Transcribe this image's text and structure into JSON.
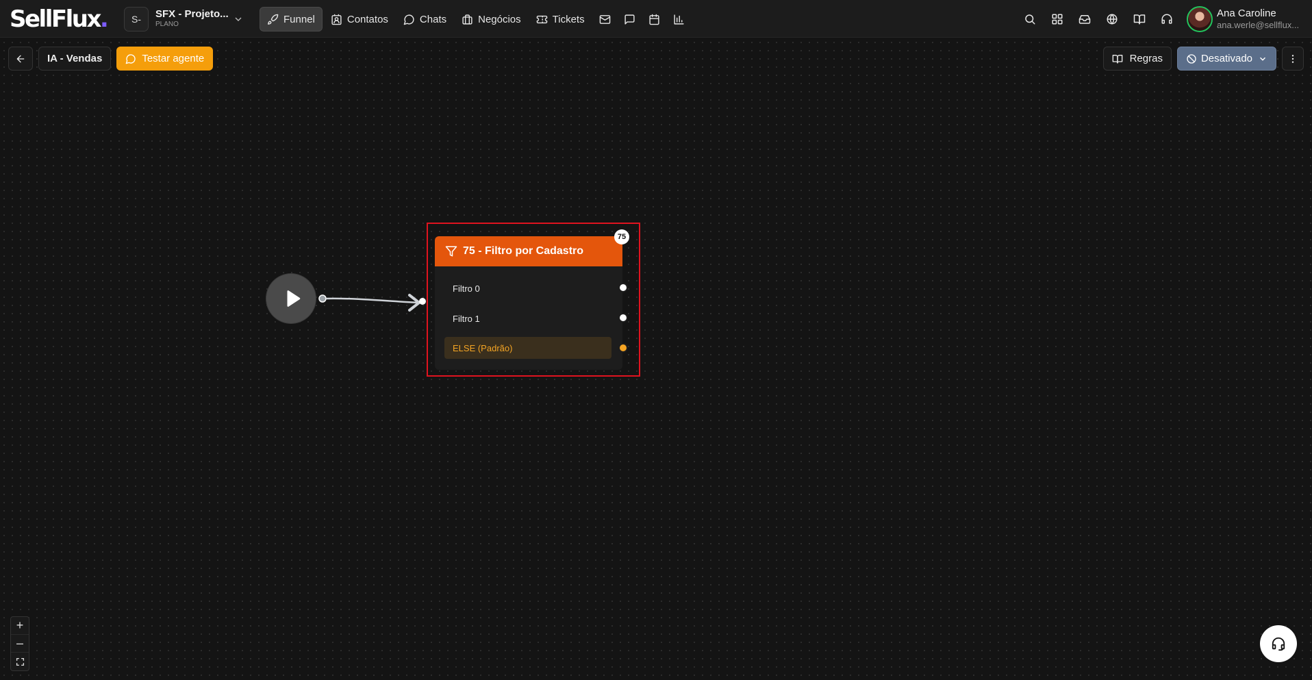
{
  "app": {
    "logo_text": "SellFlux",
    "logo_dot": "."
  },
  "project": {
    "initials": "S-",
    "name": "SFX - Projeto...",
    "plan": "PLANO"
  },
  "nav": {
    "items": [
      {
        "label": "Funnel",
        "icon": "rocket-icon",
        "active": true
      },
      {
        "label": "Contatos",
        "icon": "contacts-icon"
      },
      {
        "label": "Chats",
        "icon": "chat-icon"
      },
      {
        "label": "Negócios",
        "icon": "briefcase-icon"
      },
      {
        "label": "Tickets",
        "icon": "ticket-icon"
      }
    ],
    "extra_icons": [
      "mail-icon",
      "message-square-icon",
      "calendar-icon",
      "bar-chart-icon"
    ]
  },
  "header_right": {
    "icons": [
      "search-icon",
      "apps-grid-icon",
      "inbox-icon",
      "globe-icon",
      "book-icon",
      "headset-icon"
    ]
  },
  "user": {
    "name": "Ana Caroline",
    "email": "ana.werle@sellflux..."
  },
  "editor": {
    "title": "IA - Vendas",
    "test_label": "Testar agente",
    "rules_label": "Regras",
    "status_label": "Desativado"
  },
  "node": {
    "badge": "75",
    "title": "75 - Filtro por Cadastro",
    "outputs": [
      {
        "label": "Filtro 0"
      },
      {
        "label": "Filtro 1"
      },
      {
        "label": "ELSE (Padrão)"
      }
    ]
  },
  "zoom": {
    "zoom_in": "+",
    "zoom_out": "–"
  },
  "colors": {
    "accent_orange": "#e4560c",
    "test_button": "#f59e0b",
    "status_button": "#5b6e8a",
    "highlight": "#e0131f",
    "logo_dot": "#7c5cff"
  }
}
